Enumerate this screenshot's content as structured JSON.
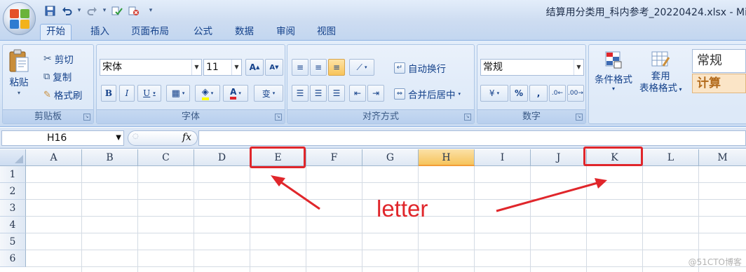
{
  "app": {
    "window_title": "结算用分类用_科内参考_20220424.xlsx - Mi"
  },
  "qat": {
    "items": [
      {
        "name": "save-icon",
        "glyph": "▣"
      },
      {
        "name": "undo-icon",
        "glyph": "↶"
      },
      {
        "name": "redo-icon",
        "glyph": "↷"
      },
      {
        "name": "check-icon",
        "glyph": "✓"
      },
      {
        "name": "erase-icon",
        "glyph": "⊘"
      }
    ]
  },
  "tabs": [
    "开始",
    "插入",
    "页面布局",
    "公式",
    "数据",
    "审阅",
    "视图"
  ],
  "ribbon": {
    "clipboard": {
      "caption": "剪贴板",
      "paste": "粘贴",
      "cut": "剪切",
      "copy": "复制",
      "format_painter": "格式刷"
    },
    "font": {
      "caption": "字体",
      "font_name": "宋体",
      "font_size": "11",
      "bold": "B",
      "italic": "I",
      "underline": "U",
      "grow": "A",
      "shrink": "A",
      "font_color": "A",
      "wen": "变"
    },
    "alignment": {
      "caption": "对齐方式",
      "wrap": "自动换行",
      "merge": "合并后居中"
    },
    "number": {
      "caption": "数字",
      "format": "常规",
      "percent": "%",
      "comma": ","
    },
    "styles": {
      "conditional": "条件格式",
      "table_line1": "套用",
      "table_line2": "表格格式",
      "style_normal": "常规",
      "style_calc": "计算"
    }
  },
  "formula_bar": {
    "name_box": "H16",
    "fx": "fx",
    "value": ""
  },
  "columns": [
    "A",
    "B",
    "C",
    "D",
    "E",
    "F",
    "G",
    "H",
    "I",
    "J",
    "K",
    "L",
    "M"
  ],
  "selected_column": "H",
  "rows": [
    "1",
    "2",
    "3",
    "4",
    "5",
    "6"
  ],
  "annotation": {
    "text": "letter",
    "color": "#e0262b",
    "highlighted_columns": [
      "E",
      "K"
    ]
  },
  "watermark": "@51CTO博客"
}
